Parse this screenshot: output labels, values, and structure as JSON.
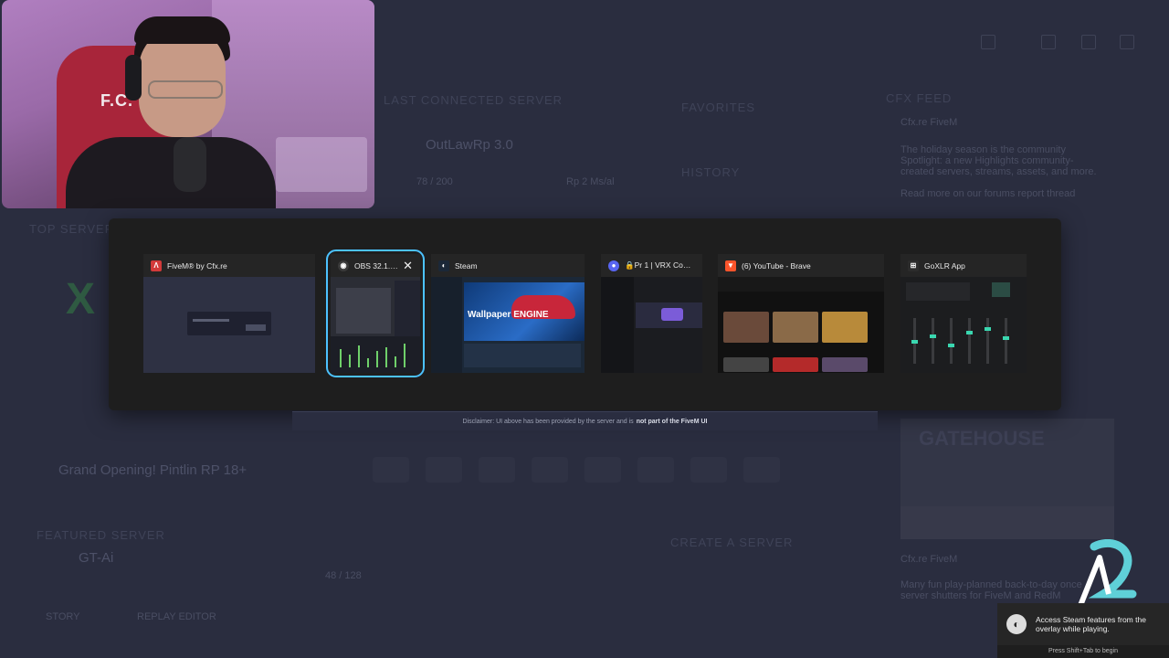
{
  "background_app": {
    "last_connected_label": "LAST CONNECTED SERVER",
    "server_name": "OutLawRp 3.0",
    "players": "78 / 200",
    "ping": "Rp 2 Ms/al",
    "favorites_label": "FAVORITES",
    "history_label": "HISTORY",
    "top_servers_label": "TOP SERVERS",
    "news_label": "CFX FEED",
    "news_author": "Cfx.re FiveM",
    "news_body": "The holiday season is the community Spotlight: a new Highlights community-created servers, streams, assets, and more.",
    "news_link": "Read more on our forums report thread",
    "grand_opening": "Grand Opening! Pintlin RP 18+",
    "featured_label": "FEATURED SERVER",
    "featured_server": "GT-Ai",
    "featured_players": "48 / 128",
    "create_server": "CREATE A SERVER",
    "story_label": "STORY",
    "replay_label": "REPLAY EDITOR",
    "news2_author": "Cfx.re FiveM",
    "news2_body": "Many fun play-planned back-to-day once server shutters for FiveM and RedM",
    "gatehouse_text": "GATEHOUSE"
  },
  "switcher": {
    "windows": [
      {
        "title": "FiveM® by Cfx.re",
        "icon": "fivem-icon",
        "color": "#d23a3a"
      },
      {
        "title": "OBS 32.1.1...",
        "icon": "obs-icon",
        "color": "#3a3a3a",
        "selected": true,
        "close": "✕"
      },
      {
        "title": "Steam",
        "icon": "steam-icon",
        "color": "#1b2838"
      },
      {
        "title": "🔒Pr 1 | VRX Comm...",
        "icon": "discord-icon",
        "color": "#5865f2"
      },
      {
        "title": "(6) YouTube - Brave",
        "icon": "brave-icon",
        "color": "#fb542b"
      },
      {
        "title": "GoXLR App",
        "icon": "goxlr-icon",
        "color": "#2c2c2c"
      }
    ],
    "steam_thumb_text": "Wallpaper ENGINE"
  },
  "disclaimer": {
    "prefix": "Disclaimer: UI above has been provided by the server and is",
    "bold": "not part of the FiveM UI"
  },
  "toast": {
    "message": "Access Steam features from the overlay while playing.",
    "hint": "Press Shift+Tab to begin"
  },
  "webcam": {
    "shirt_text": "F.C."
  }
}
